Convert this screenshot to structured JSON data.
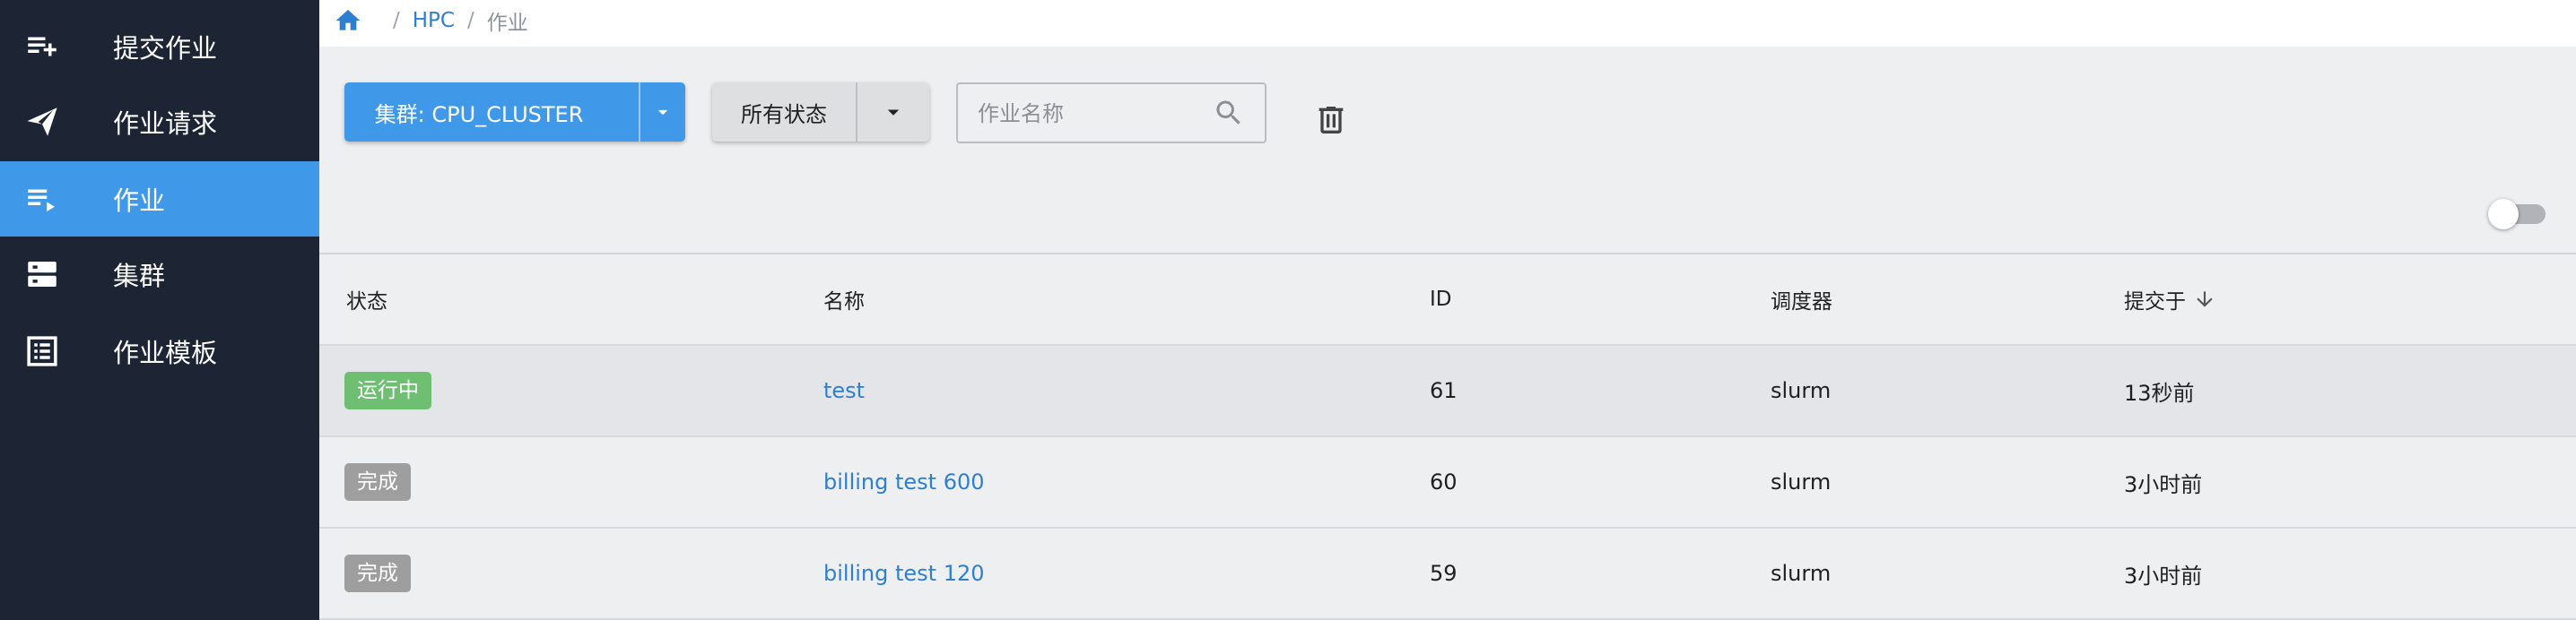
{
  "sidebar": {
    "items": [
      {
        "label": "提交作业",
        "icon": "playlist-add-icon",
        "active": false
      },
      {
        "label": "作业请求",
        "icon": "send-icon",
        "active": false
      },
      {
        "label": "作业",
        "icon": "playlist-play-icon",
        "active": true
      },
      {
        "label": "集群",
        "icon": "server-icon",
        "active": false
      },
      {
        "label": "作业模板",
        "icon": "list-alt-icon",
        "active": false
      }
    ]
  },
  "breadcrumb": {
    "items": [
      "HPC",
      "作业"
    ],
    "home_icon": "home-icon"
  },
  "toolbar": {
    "cluster_label": "集群: CPU_CLUSTER",
    "status_label": "所有状态",
    "search_placeholder": "作业名称",
    "search_value": ""
  },
  "table": {
    "headers": [
      "状态",
      "名称",
      "ID",
      "调度器",
      "提交于"
    ],
    "sort_icon": "arrow-down-icon",
    "rows": [
      {
        "status": "运行中",
        "status_color": "#6fbf73",
        "name": "test",
        "id": "61",
        "scheduler": "slurm",
        "submitted": "13秒前"
      },
      {
        "status": "完成",
        "status_color": "#9e9e9e",
        "name": "billing test 600",
        "id": "60",
        "scheduler": "slurm",
        "submitted": "3小时前"
      },
      {
        "status": "完成",
        "status_color": "#9e9e9e",
        "name": "billing test 120",
        "id": "59",
        "scheduler": "slurm",
        "submitted": "3小时前"
      }
    ]
  },
  "colors": {
    "sidebar_bg": "#1d2433",
    "accent": "#4098e8",
    "link": "#2f7fd1"
  }
}
